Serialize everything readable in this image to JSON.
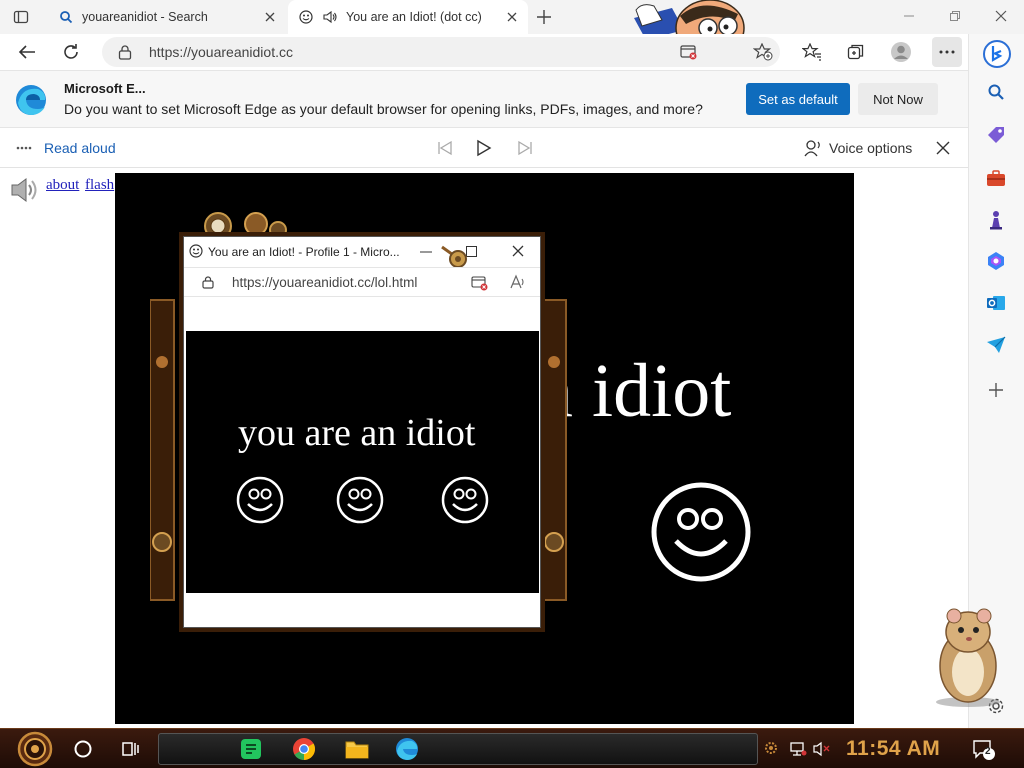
{
  "tabs": [
    {
      "title": "youareanidiot - Search",
      "icon": "search-icon"
    },
    {
      "title": "You are an Idiot! (dot cc)",
      "icon": "smiley-icon"
    }
  ],
  "address": {
    "url": "https://youareanidiot.cc"
  },
  "infobar": {
    "title": "Microsoft E...",
    "message": "Do you want to set Microsoft Edge as your default browser for opening links, PDFs, images, and more?",
    "primary_button": "Set as default",
    "secondary_button": "Not Now"
  },
  "read_aloud": {
    "label": "Read aloud",
    "voice_options": "Voice options"
  },
  "page": {
    "links": {
      "about": "about",
      "flash": "flash"
    },
    "big_text": "n idiot"
  },
  "popup": {
    "title": "You are an Idiot! - Profile 1 - Micro...",
    "url": "https://youareanidiot.cc/lol.html",
    "text": "you are an idiot"
  },
  "taskbar": {
    "clock": "11:54 AM",
    "notification_count": "2"
  },
  "colors": {
    "accent": "#0f6cbd",
    "clock": "#e0a34a",
    "stage": "#000000"
  }
}
